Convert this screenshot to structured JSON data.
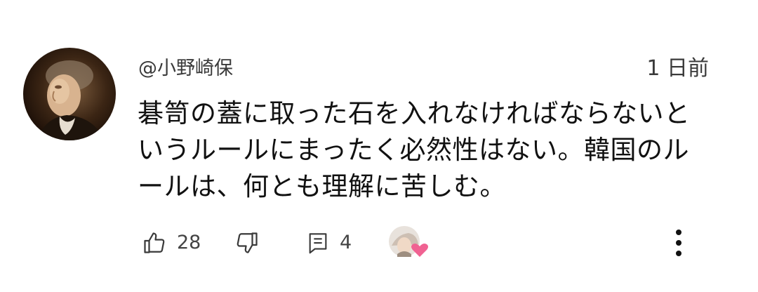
{
  "comment": {
    "author": "@小野崎保",
    "time": "1 日前",
    "body_lines": [
      "碁笥の蓋に取った石を入れなければならないと",
      "いうルールにまったく必然性はない。韓国のル",
      "ールは、何とも理解に苦しむ。"
    ],
    "likes": "28",
    "replies": "4"
  },
  "icons": {
    "like": "thumbs-up-icon",
    "dislike": "thumbs-down-icon",
    "reply": "comment-icon",
    "creator_heart": "creator-heart-icon",
    "more": "more-vertical-icon"
  },
  "colors": {
    "heart": "#f06292",
    "text": "#111111",
    "meta": "#3a3a3a"
  }
}
